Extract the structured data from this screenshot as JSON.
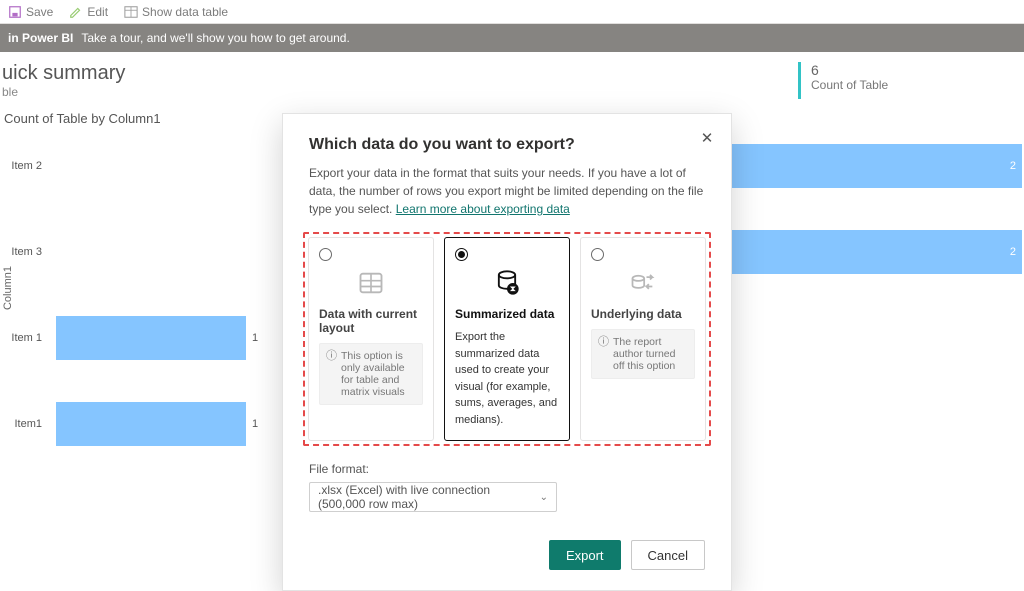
{
  "toolbar": {
    "save": "Save",
    "edit": "Edit",
    "show_data": "Show data table"
  },
  "banner": {
    "bold": "in Power BI",
    "text": "Take a tour, and we'll show you how to get around."
  },
  "summary": {
    "title": "uick summary",
    "sub": "ble",
    "card_value": "6",
    "card_label": "Count of Table"
  },
  "chart_title": "Count of Table by Column1",
  "axis_label": "Column1",
  "chart_data": {
    "type": "bar",
    "orientation": "horizontal",
    "categories": [
      "Item 2",
      "Item 3",
      "Item 1",
      "Item1"
    ],
    "series": [
      {
        "name": "left",
        "values": [
          null,
          null,
          1,
          1
        ]
      },
      {
        "name": "right",
        "values": [
          2,
          2,
          null,
          null
        ]
      }
    ],
    "xlim_left": [
      0,
      2
    ],
    "title": "Count of Table by Column1"
  },
  "modal": {
    "title": "Which data do you want to export?",
    "desc1": "Export your data in the format that suits your needs. If you have a lot of data, the number of rows you export might be limited depending on the file type you select. ",
    "link": "Learn more about exporting data",
    "options": [
      {
        "title": "Data with current layout",
        "note": "This option is only available for table and matrix visuals",
        "disabled": true
      },
      {
        "title": "Summarized data",
        "body": "Export the summarized data used to create your visual (for example, sums, averages, and medians).",
        "selected": true
      },
      {
        "title": "Underlying data",
        "note": "The report author turned off this option",
        "disabled": true
      }
    ],
    "file_format_label": "File format:",
    "file_format_value": ".xlsx (Excel) with live connection (500,000 row max)",
    "export": "Export",
    "cancel": "Cancel"
  }
}
